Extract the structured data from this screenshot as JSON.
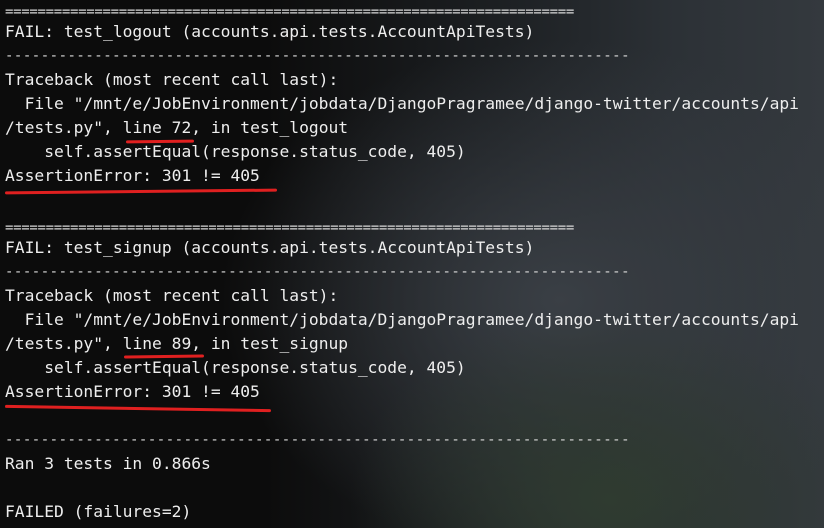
{
  "terminal": {
    "sep_eq": "======================================================================",
    "sep_dash": "----------------------------------------------------------------------",
    "failures": [
      {
        "header": "FAIL: test_logout (accounts.api.tests.AccountApiTests)",
        "traceback": "Traceback (most recent call last):",
        "file_line": "  File \"/mnt/e/JobEnvironment/jobdata/DjangoPragramee/django-twitter/accounts/api",
        "path_start": "/tests.py\", ",
        "line_ref": "line 72",
        "path_end": ", in test_logout",
        "code": "    self.assertEqual(response.status_code, 405)",
        "error": "AssertionError: 301 != 405"
      },
      {
        "header": "FAIL: test_signup (accounts.api.tests.AccountApiTests)",
        "traceback": "Traceback (most recent call last):",
        "file_line": "  File \"/mnt/e/JobEnvironment/jobdata/DjangoPragramee/django-twitter/accounts/api",
        "path_start": "/tests.py\", ",
        "line_ref": "line 89",
        "path_end": ", in test_signup",
        "code": "    self.assertEqual(response.status_code, 405)",
        "error": "AssertionError: 301 != 405"
      }
    ],
    "summary": "Ran 3 tests in 0.866s",
    "result": "FAILED (failures=2)"
  },
  "colors": {
    "text": "#eeeeee",
    "annotation": "#e02020",
    "background": "#0c0c0c"
  }
}
